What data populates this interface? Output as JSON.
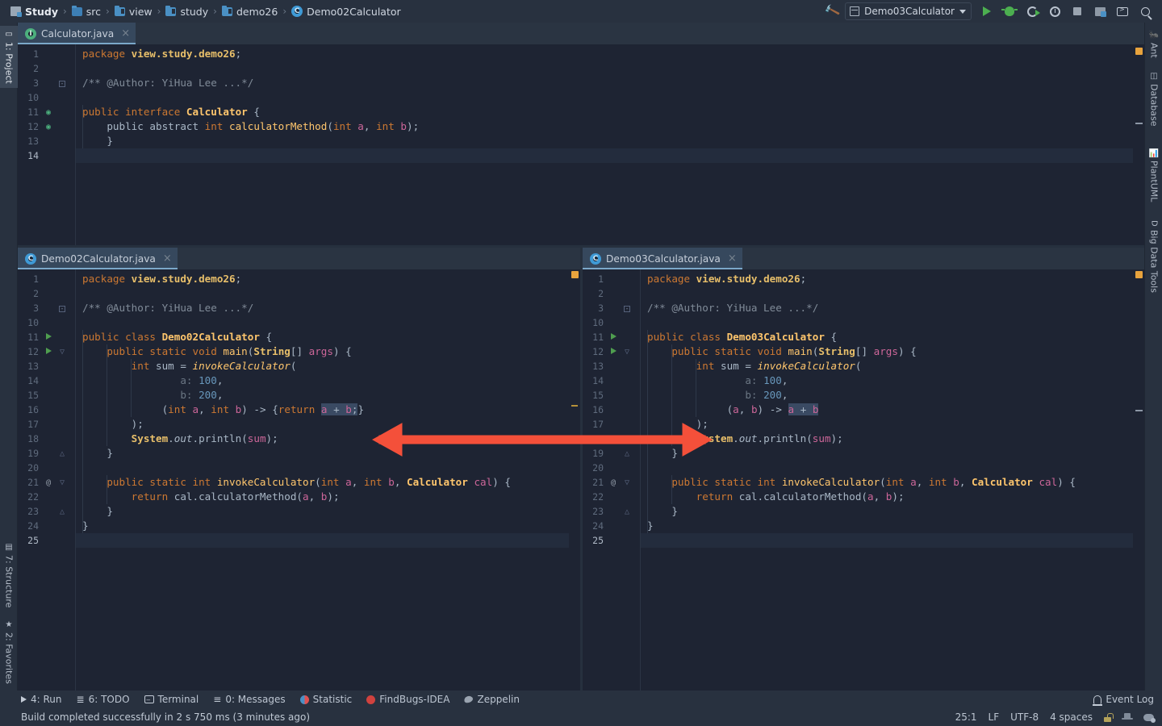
{
  "window": {
    "accent": "#4a90c4",
    "arrow_color": "#f4503a",
    "editor_bg": "#1e2433",
    "chrome_bg": "#28313f"
  },
  "breadcrumb": {
    "items": [
      {
        "label": "Study",
        "icon": "module-icon",
        "root": true
      },
      {
        "label": "src",
        "icon": "folder-icon"
      },
      {
        "label": "view",
        "icon": "folder-icon"
      },
      {
        "label": "study",
        "icon": "folder-icon"
      },
      {
        "label": "demo26",
        "icon": "folder-icon"
      },
      {
        "label": "Demo02Calculator",
        "icon": "class-icon"
      }
    ],
    "separator": "›"
  },
  "toolbar": {
    "build_icon": "hammer-icon",
    "run_config": "Demo03Calculator",
    "run_icon": "run-icon",
    "debug_icon": "debug-icon",
    "coverage_icon": "run-with-coverage-icon",
    "profiler_icon": "profiler-icon",
    "stop_icon": "stop-icon",
    "project_structure_icon": "project-structure-icon",
    "terminal_icon": "terminal-icon",
    "search_icon": "search-everywhere-icon"
  },
  "left_strip": {
    "top": [
      {
        "label": "1: Project",
        "icon": "project-icon",
        "active": true
      }
    ],
    "bottom": [
      {
        "label": "7: Structure",
        "icon": "structure-icon"
      },
      {
        "label": "2: Favorites",
        "icon": "star-icon"
      }
    ]
  },
  "right_strip": {
    "items": [
      {
        "label": "Ant",
        "icon": "ant-icon"
      },
      {
        "label": "Database",
        "icon": "database-icon"
      },
      {
        "label": "PlantUML",
        "icon": "plantuml-icon"
      },
      {
        "label": "Big Data Tools",
        "icon": "big-data-tools-icon"
      }
    ]
  },
  "editors": {
    "top": {
      "tab": {
        "label": "Calculator.java",
        "icon": "interface-icon",
        "close": "×"
      },
      "lines": [
        {
          "n": "1",
          "icon": "",
          "fold": ""
        },
        {
          "n": "2",
          "icon": "",
          "fold": ""
        },
        {
          "n": "3",
          "icon": "",
          "fold": "minus"
        },
        {
          "n": "10",
          "icon": "",
          "fold": ""
        },
        {
          "n": "11",
          "icon": "interface-impl",
          "fold": ""
        },
        {
          "n": "12",
          "icon": "interface-impl",
          "fold": ""
        },
        {
          "n": "13",
          "icon": "",
          "fold": ""
        },
        {
          "n": "14",
          "icon": "",
          "fold": "",
          "current": true
        }
      ],
      "code": [
        "package view.study.demo26;",
        "",
        "/** @Author: YiHua Lee ...*/",
        "",
        "public interface Calculator {",
        "    public abstract int calculatorMethod(int a, int b);",
        "}",
        ""
      ]
    },
    "bottom_left": {
      "tab": {
        "label": "Demo02Calculator.java",
        "icon": "class-icon",
        "close": "×"
      },
      "lines": [
        {
          "n": "1",
          "icon": "",
          "fold": ""
        },
        {
          "n": "2",
          "icon": "",
          "fold": ""
        },
        {
          "n": "3",
          "icon": "",
          "fold": "minus"
        },
        {
          "n": "10",
          "icon": "",
          "fold": ""
        },
        {
          "n": "11",
          "icon": "run",
          "fold": ""
        },
        {
          "n": "12",
          "icon": "run",
          "fold": "open"
        },
        {
          "n": "13",
          "icon": "",
          "fold": ""
        },
        {
          "n": "14",
          "icon": "",
          "fold": ""
        },
        {
          "n": "15",
          "icon": "",
          "fold": ""
        },
        {
          "n": "16",
          "icon": "",
          "fold": ""
        },
        {
          "n": "17",
          "icon": "",
          "fold": ""
        },
        {
          "n": "18",
          "icon": "",
          "fold": ""
        },
        {
          "n": "19",
          "icon": "",
          "fold": "close"
        },
        {
          "n": "20",
          "icon": "",
          "fold": ""
        },
        {
          "n": "21",
          "icon": "at",
          "fold": "open"
        },
        {
          "n": "22",
          "icon": "",
          "fold": ""
        },
        {
          "n": "23",
          "icon": "",
          "fold": "close"
        },
        {
          "n": "24",
          "icon": "",
          "fold": ""
        },
        {
          "n": "25",
          "icon": "",
          "fold": "",
          "current": true
        }
      ],
      "code_text": [
        "package view.study.demo26;",
        "",
        "/** @Author: YiHua Lee ...*/",
        "",
        "public class Demo02Calculator {",
        "    public static void main(String[] args) {",
        "        int sum = invokeCalculator(",
        "                a: 100,",
        "                b: 200,",
        "                (int a, int b) -> {return a + b;}",
        "        );",
        "        System.out.println(sum);",
        "    }",
        "",
        "    public static int invokeCalculator(int a, int b, Calculator cal) {",
        "        return cal.calculatorMethod(a, b);",
        "    }",
        "}",
        ""
      ]
    },
    "bottom_right": {
      "tab": {
        "label": "Demo03Calculator.java",
        "icon": "class-icon",
        "close": "×"
      },
      "lines": [
        {
          "n": "1",
          "icon": "",
          "fold": ""
        },
        {
          "n": "2",
          "icon": "",
          "fold": ""
        },
        {
          "n": "3",
          "icon": "",
          "fold": "minus"
        },
        {
          "n": "10",
          "icon": "",
          "fold": ""
        },
        {
          "n": "11",
          "icon": "run",
          "fold": ""
        },
        {
          "n": "12",
          "icon": "run",
          "fold": "open"
        },
        {
          "n": "13",
          "icon": "",
          "fold": ""
        },
        {
          "n": "14",
          "icon": "",
          "fold": ""
        },
        {
          "n": "15",
          "icon": "",
          "fold": ""
        },
        {
          "n": "16",
          "icon": "",
          "fold": ""
        },
        {
          "n": "17",
          "icon": "",
          "fold": ""
        },
        {
          "n": "18",
          "icon": "",
          "fold": ""
        },
        {
          "n": "19",
          "icon": "",
          "fold": "close"
        },
        {
          "n": "20",
          "icon": "",
          "fold": ""
        },
        {
          "n": "21",
          "icon": "at",
          "fold": "open"
        },
        {
          "n": "22",
          "icon": "",
          "fold": ""
        },
        {
          "n": "23",
          "icon": "",
          "fold": "close"
        },
        {
          "n": "24",
          "icon": "",
          "fold": ""
        },
        {
          "n": "25",
          "icon": "",
          "fold": "",
          "current": true
        }
      ],
      "code_text": [
        "package view.study.demo26;",
        "",
        "/** @Author: YiHua Lee ...*/",
        "",
        "public class Demo03Calculator {",
        "    public static void main(String[] args) {",
        "        int sum = invokeCalculator(",
        "                a: 100,",
        "                b: 200,",
        "                (a, b) -> a + b",
        "        );",
        "        System.out.println(sum);",
        "    }",
        "",
        "    public static int invokeCalculator(int a, int b, Calculator cal) {",
        "        return cal.calculatorMethod(a, b);",
        "    }",
        "}",
        ""
      ]
    }
  },
  "annotation": {
    "type": "double-headed-arrow",
    "color": "#f4503a",
    "meaning": "compares lambda written with explicit types/block body to concise lambda"
  },
  "bottom_toolbar": {
    "items": [
      {
        "label": "4: Run",
        "mnemonic": "4",
        "icon": "run-icon"
      },
      {
        "label": "6: TODO",
        "mnemonic": "6",
        "icon": "todo-icon"
      },
      {
        "label": "Terminal",
        "mnemonic": "",
        "icon": "terminal-icon"
      },
      {
        "label": "0: Messages",
        "mnemonic": "0",
        "icon": "messages-icon"
      },
      {
        "label": "Statistic",
        "mnemonic": "",
        "icon": "statistic-icon"
      },
      {
        "label": "FindBugs-IDEA",
        "mnemonic": "",
        "icon": "findbugs-icon"
      },
      {
        "label": "Zeppelin",
        "mnemonic": "",
        "icon": "zeppelin-icon"
      }
    ],
    "event_log": "Event Log"
  },
  "status_bar": {
    "message": "Build completed successfully in 2 s 750 ms (3 minutes ago)",
    "caret": "25:1",
    "line_separator": "LF",
    "encoding": "UTF-8",
    "indent": "4 spaces",
    "lock_icon": "lock-icon",
    "inspector_icon": "inspector-icon",
    "sync_icon": "background-tasks-icon"
  }
}
